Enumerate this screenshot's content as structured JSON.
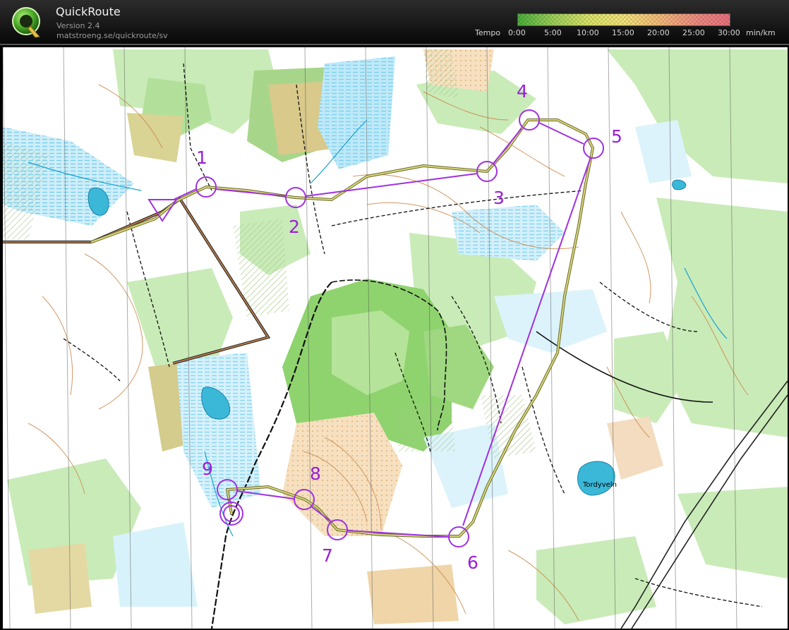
{
  "app": {
    "name": "QuickRoute",
    "version": "Version 2.4",
    "url": "matstroeng.se/quickroute/sv"
  },
  "legend": {
    "label": "Tempo",
    "ticks": [
      "0:00",
      "5:00",
      "10:00",
      "15:00",
      "20:00",
      "25:00",
      "30:00"
    ],
    "unit": "min/km",
    "colors": [
      "#4caf3c",
      "#9ed05a",
      "#dce46a",
      "#f3e37a",
      "#f3b979",
      "#ee8c80",
      "#e9717e"
    ]
  },
  "map": {
    "place_names": [
      "Tordyveln"
    ],
    "course_color": "#a030e0",
    "controls": [
      "1",
      "2",
      "3",
      "4",
      "5",
      "6",
      "7",
      "8",
      "9"
    ]
  }
}
